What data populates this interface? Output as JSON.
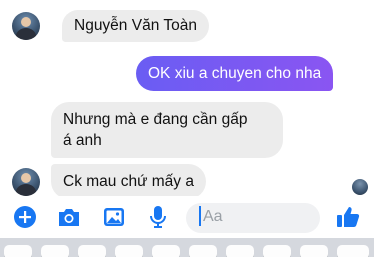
{
  "conversation": {
    "contact_name": "Nguyễn Văn Toàn",
    "messages": [
      {
        "direction": "outgoing",
        "text": "OK xiu a chuyen cho nha"
      },
      {
        "direction": "incoming",
        "line1": "Nhưng mà e đang cần gấp",
        "line2": "á anh"
      },
      {
        "direction": "incoming",
        "text": "Ck mau chứ mấy a"
      }
    ]
  },
  "composer": {
    "placeholder": "Aa",
    "icons": [
      "plus-icon",
      "camera-icon",
      "image-icon",
      "microphone-icon",
      "emoji-icon",
      "thumbs-up-icon"
    ]
  },
  "colors": {
    "accent": "#1877f2",
    "outgoing_bubble": "#7c5cf5",
    "incoming_bubble": "#ececec"
  }
}
